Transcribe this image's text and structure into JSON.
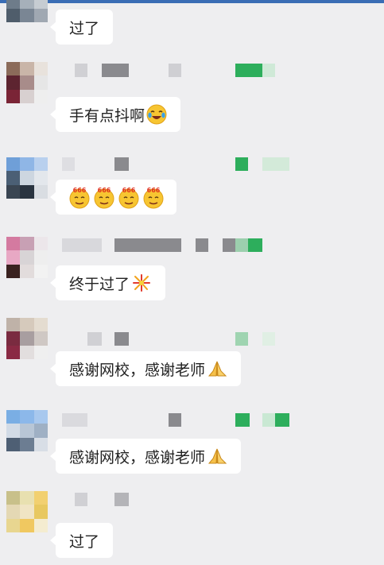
{
  "messages": [
    {
      "text": "过了",
      "emoji": null
    },
    {
      "text": "手有点抖啊",
      "emoji": "laughing-tears-icon"
    },
    {
      "text": "",
      "emoji": "emoji-666-icon",
      "count": 4,
      "emoji_label": "666"
    },
    {
      "text": "终于过了",
      "emoji": "firework-icon"
    },
    {
      "text": "感谢网校，感谢老师",
      "emoji": "folded-hands-icon"
    },
    {
      "text": "感谢网校，感谢老师",
      "emoji": "folded-hands-icon"
    },
    {
      "text": "过了",
      "emoji": null
    }
  ],
  "colors": {
    "background": "#eeeef0",
    "bubble": "#ffffff",
    "top_bar": "#3a6db5",
    "name_mosaic_gray": "#8a8a8e",
    "name_mosaic_green": "#2dae5c"
  }
}
